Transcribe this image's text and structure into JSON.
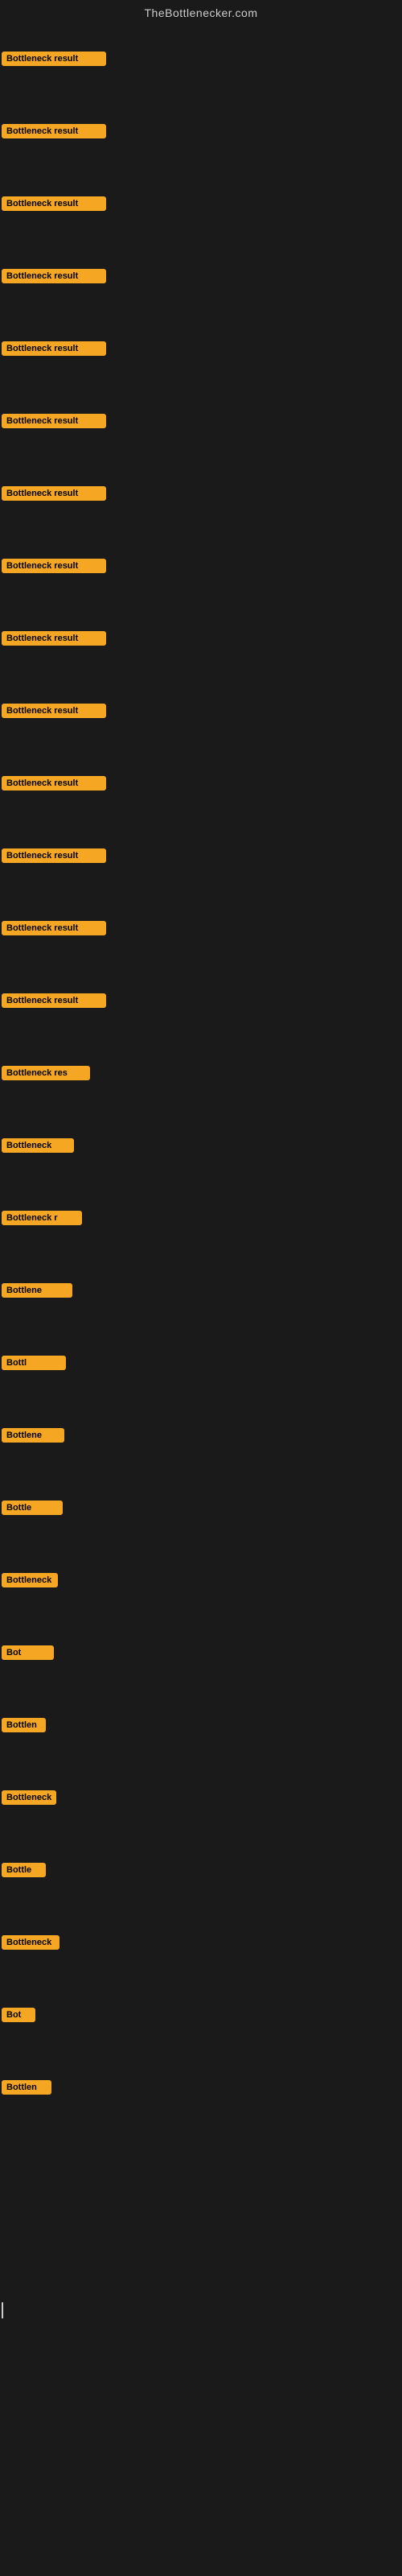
{
  "site": {
    "title": "TheBottlenecker.com"
  },
  "rows": [
    {
      "id": 1,
      "label": "Bottleneck result"
    },
    {
      "id": 2,
      "label": "Bottleneck result"
    },
    {
      "id": 3,
      "label": "Bottleneck result"
    },
    {
      "id": 4,
      "label": "Bottleneck result"
    },
    {
      "id": 5,
      "label": "Bottleneck result"
    },
    {
      "id": 6,
      "label": "Bottleneck result"
    },
    {
      "id": 7,
      "label": "Bottleneck result"
    },
    {
      "id": 8,
      "label": "Bottleneck result"
    },
    {
      "id": 9,
      "label": "Bottleneck result"
    },
    {
      "id": 10,
      "label": "Bottleneck result"
    },
    {
      "id": 11,
      "label": "Bottleneck result"
    },
    {
      "id": 12,
      "label": "Bottleneck result"
    },
    {
      "id": 13,
      "label": "Bottleneck result"
    },
    {
      "id": 14,
      "label": "Bottleneck result"
    },
    {
      "id": 15,
      "label": "Bottleneck res"
    },
    {
      "id": 16,
      "label": "Bottleneck"
    },
    {
      "id": 17,
      "label": "Bottleneck r"
    },
    {
      "id": 18,
      "label": "Bottlene"
    },
    {
      "id": 19,
      "label": "Bottl"
    },
    {
      "id": 20,
      "label": "Bottlene"
    },
    {
      "id": 21,
      "label": "Bottle"
    },
    {
      "id": 22,
      "label": "Bottleneck"
    },
    {
      "id": 23,
      "label": "Bot"
    },
    {
      "id": 24,
      "label": "Bottlen"
    },
    {
      "id": 25,
      "label": "Bottleneck"
    },
    {
      "id": 26,
      "label": "Bottle"
    },
    {
      "id": 27,
      "label": "Bottleneck"
    },
    {
      "id": 28,
      "label": "Bot"
    },
    {
      "id": 29,
      "label": "Bottlen"
    }
  ]
}
